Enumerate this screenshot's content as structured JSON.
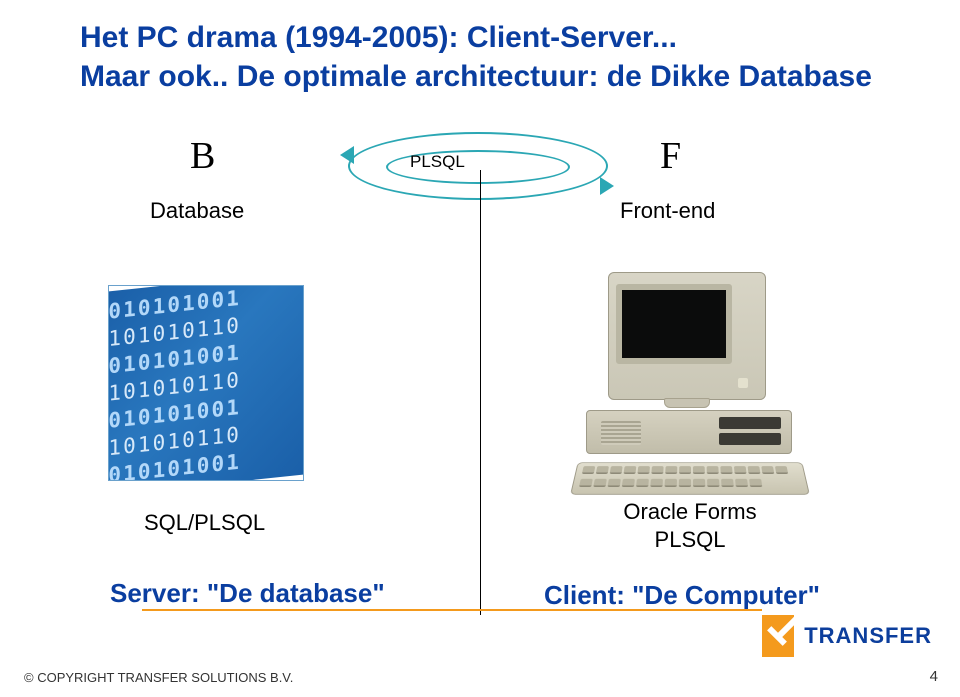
{
  "title_line1": "Het PC drama (1994-2005): Client-Server...",
  "title_line2": "Maar ook.. De optimale architectuur: de Dikke Database",
  "left_letter": "B",
  "right_letter": "F",
  "left_label": "Database",
  "right_label": "Front-end",
  "connector_label": "PLSQL",
  "bottom_left_caption": "SQL/PLSQL",
  "bottom_right_caption_line1": "Oracle Forms",
  "bottom_right_caption_line2": "PLSQL",
  "server_text": "Server: \"De database\"",
  "client_text": "Client: \"De Computer\"",
  "footer_text": "© COPYRIGHT TRANSFER SOLUTIONS B.V.",
  "page_number": "4",
  "logo_text": "TRANSFER"
}
